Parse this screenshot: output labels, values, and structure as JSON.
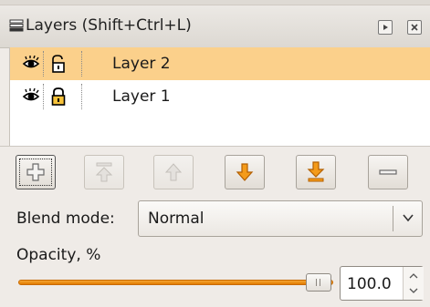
{
  "panel": {
    "title": "Layers (Shift+Ctrl+L)",
    "title_icon": "layers-stack-icon",
    "buttons": [
      {
        "name": "dock-toggle",
        "icon": "play-box-icon"
      },
      {
        "name": "close",
        "icon": "close-box-icon"
      }
    ]
  },
  "layers": [
    {
      "name": "Layer 2",
      "visible": true,
      "locked": false,
      "selected": true
    },
    {
      "name": "Layer 1",
      "visible": true,
      "locked": true,
      "selected": false
    }
  ],
  "toolbar": [
    {
      "id": "add-layer",
      "icon": "plus-icon",
      "enabled": true
    },
    {
      "id": "raise-to-top",
      "icon": "arrow-up-to-top-icon",
      "enabled": false
    },
    {
      "id": "raise-layer",
      "icon": "arrow-up-icon",
      "enabled": false
    },
    {
      "id": "lower-layer",
      "icon": "arrow-down-icon",
      "enabled": true
    },
    {
      "id": "lower-to-bottom",
      "icon": "arrow-down-to-bottom-icon",
      "enabled": true
    },
    {
      "id": "delete-layer",
      "icon": "minus-icon",
      "enabled": true
    }
  ],
  "blend": {
    "label": "Blend mode:",
    "value": "Normal"
  },
  "opacity": {
    "label": "Opacity, %",
    "value": "100.0",
    "fraction": 1.0
  },
  "colors": {
    "selection": "#fbd08b",
    "accent_orange": "#f49b1a",
    "panel_bg": "#efebe7"
  }
}
